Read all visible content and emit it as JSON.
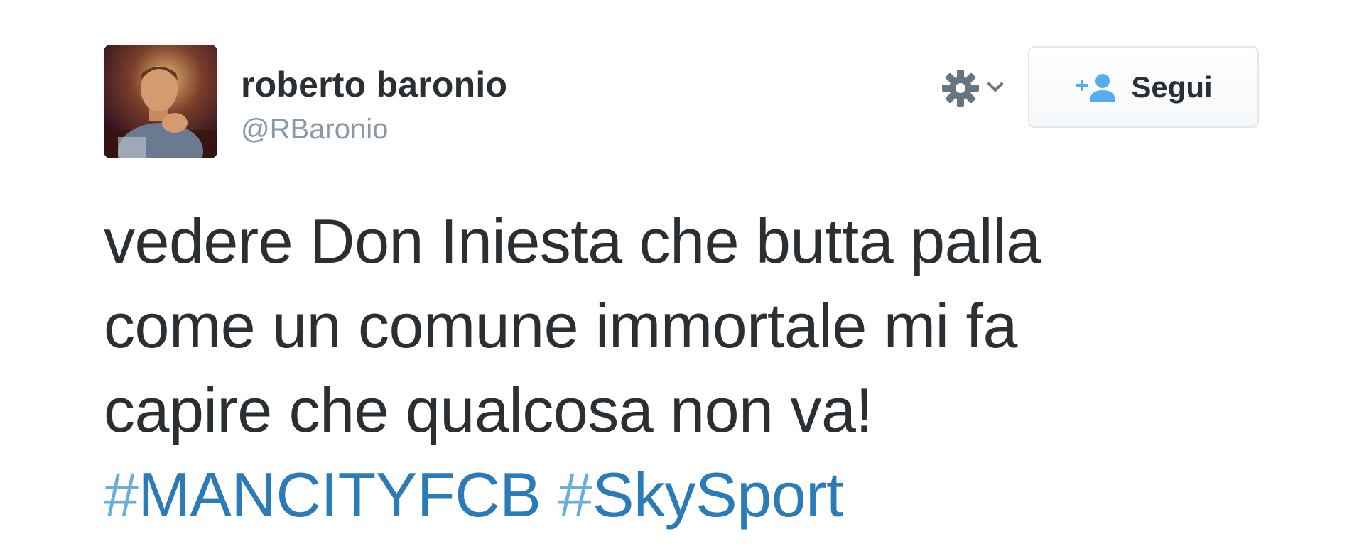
{
  "author": {
    "display_name": "roberto baronio",
    "handle": "@RBaronio"
  },
  "actions": {
    "follow_label": "Segui",
    "gear_icon": "gear-icon",
    "follow_icon": "add-user-icon"
  },
  "tweet": {
    "lines": [
      "vedere Don Iniesta che butta palla",
      "come un comune immortale mi fa",
      "capire che qualcosa non va!"
    ],
    "hashtags": [
      {
        "hash": "#",
        "tag": "MANCITYFCB"
      },
      {
        "hash": "#",
        "tag": "SkySport"
      }
    ]
  },
  "colors": {
    "text": "#292f33",
    "muted": "#8899a6",
    "link": "#2b7bb9",
    "button_border": "#e1e8ed"
  }
}
